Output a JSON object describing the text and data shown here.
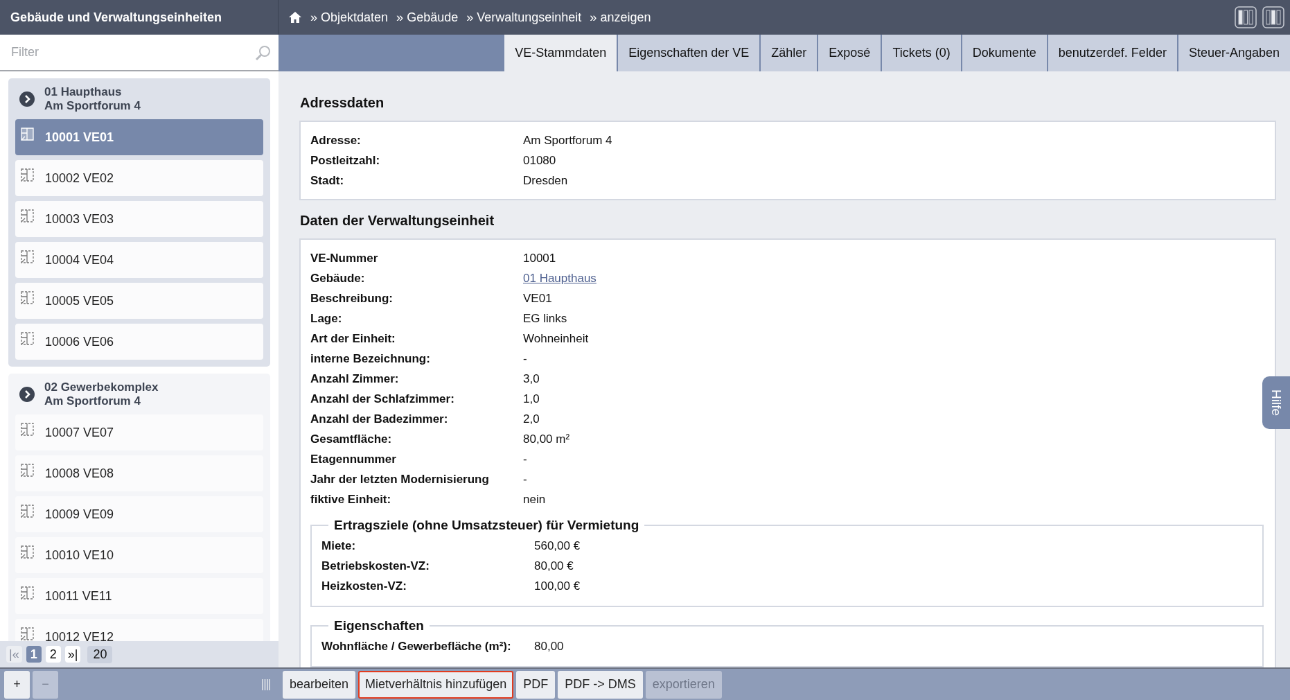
{
  "sidebar": {
    "title": "Gebäude und Verwaltungseinheiten",
    "filter": {
      "placeholder": "Filter"
    },
    "groups": [
      {
        "name": "01 Haupthaus",
        "address": "Am Sportforum 4",
        "selected": true,
        "items": [
          {
            "label": "10001 VE01",
            "selected": true
          },
          {
            "label": "10002 VE02",
            "selected": false
          },
          {
            "label": "10003 VE03",
            "selected": false
          },
          {
            "label": "10004 VE04",
            "selected": false
          },
          {
            "label": "10005 VE05",
            "selected": false
          },
          {
            "label": "10006 VE06",
            "selected": false
          }
        ]
      },
      {
        "name": "02 Gewerbekomplex",
        "address": "Am Sportforum 4",
        "selected": false,
        "items": [
          {
            "label": "10007 VE07",
            "selected": false
          },
          {
            "label": "10008 VE08",
            "selected": false
          },
          {
            "label": "10009 VE09",
            "selected": false
          },
          {
            "label": "10010 VE10",
            "selected": false
          },
          {
            "label": "10011 VE11",
            "selected": false
          },
          {
            "label": "10012 VE12",
            "selected": false
          }
        ]
      }
    ],
    "pager": [
      {
        "label": "|«",
        "selected": false,
        "disabled": true
      },
      {
        "label": "1",
        "selected": true,
        "disabled": false
      },
      {
        "label": "2",
        "selected": false,
        "disabled": false
      },
      {
        "label": "»|",
        "selected": false,
        "disabled": false
      }
    ],
    "page_size": "20",
    "tools": [
      {
        "label": "+",
        "disabled": false
      },
      {
        "label": "−",
        "disabled": true
      }
    ]
  },
  "breadcrumb": [
    {
      "sep": "»",
      "label": "Objektdaten"
    },
    {
      "sep": "»",
      "label": "Gebäude"
    },
    {
      "sep": "»",
      "label": "Verwaltungseinheit"
    },
    {
      "sep": "»",
      "label": "anzeigen"
    }
  ],
  "tabs": [
    {
      "label": "VE-Stammdaten",
      "selected": true
    },
    {
      "label": "Eigenschaften der VE",
      "selected": false
    },
    {
      "label": "Zähler",
      "selected": false
    },
    {
      "label": "Exposé",
      "selected": false
    },
    {
      "label": "Tickets (0)",
      "selected": false
    },
    {
      "label": "Dokumente",
      "selected": false
    },
    {
      "label": "benutzerdef. Felder",
      "selected": false
    },
    {
      "label": "Steuer-Angaben",
      "selected": false
    }
  ],
  "sections": [
    {
      "title": "Adressdaten",
      "rows": [
        {
          "label": "Adresse:",
          "value": "Am Sportforum 4"
        },
        {
          "label": "Postleitzahl:",
          "value": "01080"
        },
        {
          "label": "Stadt:",
          "value": "Dresden"
        }
      ]
    },
    {
      "title": "Daten der Verwaltungseinheit",
      "rows": [
        {
          "label": "VE-Nummer",
          "value": "10001"
        },
        {
          "label": "Gebäude:",
          "value": "01 Haupthaus",
          "kind": "link"
        },
        {
          "label": "Beschreibung:",
          "value": "VE01"
        },
        {
          "label": "Lage:",
          "value": "EG links"
        },
        {
          "label": "Art der Einheit:",
          "value": "Wohneinheit"
        },
        {
          "label": "interne Bezeichnung:",
          "value": "-"
        },
        {
          "label": "Anzahl Zimmer:",
          "value": "3,0"
        },
        {
          "label": "Anzahl der Schlafzimmer:",
          "value": "1,0"
        },
        {
          "label": "Anzahl der Badezimmer:",
          "value": "2,0"
        },
        {
          "label": "Gesamtfläche:",
          "value": "80,00 m²"
        },
        {
          "label": "Etagennummer",
          "value": "-"
        },
        {
          "label": "Jahr der letzten Modernisierung",
          "value": "-"
        },
        {
          "label": "fiktive Einheit:",
          "value": "nein"
        }
      ],
      "fieldsets": [
        {
          "title": "Ertragsziele (ohne Umsatzsteuer) für Vermietung",
          "rows": [
            {
              "label": "Miete:",
              "value": "560,00 €"
            },
            {
              "label": "Betriebskosten-VZ:",
              "value": "80,00 €"
            },
            {
              "label": "Heizkosten-VZ:",
              "value": "100,00 €"
            }
          ]
        },
        {
          "title": "Eigenschaften",
          "rows": [
            {
              "label": "Wohnfläche / Gewerbefläche (m²):",
              "value": "80,00"
            }
          ]
        }
      ]
    }
  ],
  "actions": [
    {
      "label": "bearbeiten",
      "highlighted": false,
      "disabled": false
    },
    {
      "label": "Mietverhältnis hinzufügen",
      "highlighted": true,
      "disabled": false
    },
    {
      "label": "PDF",
      "highlighted": false,
      "disabled": false
    },
    {
      "label": "PDF -> DMS",
      "highlighted": false,
      "disabled": false
    },
    {
      "label": "exportieren",
      "highlighted": false,
      "disabled": true
    }
  ],
  "help_tab": "Hilfe"
}
